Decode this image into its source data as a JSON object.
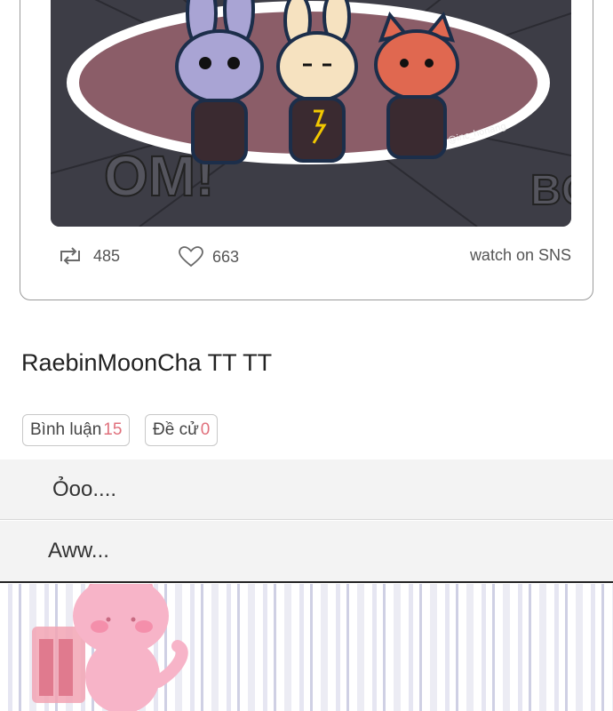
{
  "post": {
    "repost_count": "485",
    "like_count": "663",
    "watch_label": "watch on SNS",
    "art_credit": "@inc_honang"
  },
  "title": "RaebinMoonCha TT TT",
  "tabs": {
    "comments_label": "Bình luận",
    "comments_count": "15",
    "votes_label": "Đề cử",
    "votes_count": "0"
  },
  "comments": [
    {
      "text": "Ỏoo...."
    },
    {
      "text": "Aww..."
    }
  ],
  "colors": {
    "accent_count": "#e0707c",
    "card_border": "#9a9a9a",
    "comment_bg": "#f3f3f3"
  }
}
